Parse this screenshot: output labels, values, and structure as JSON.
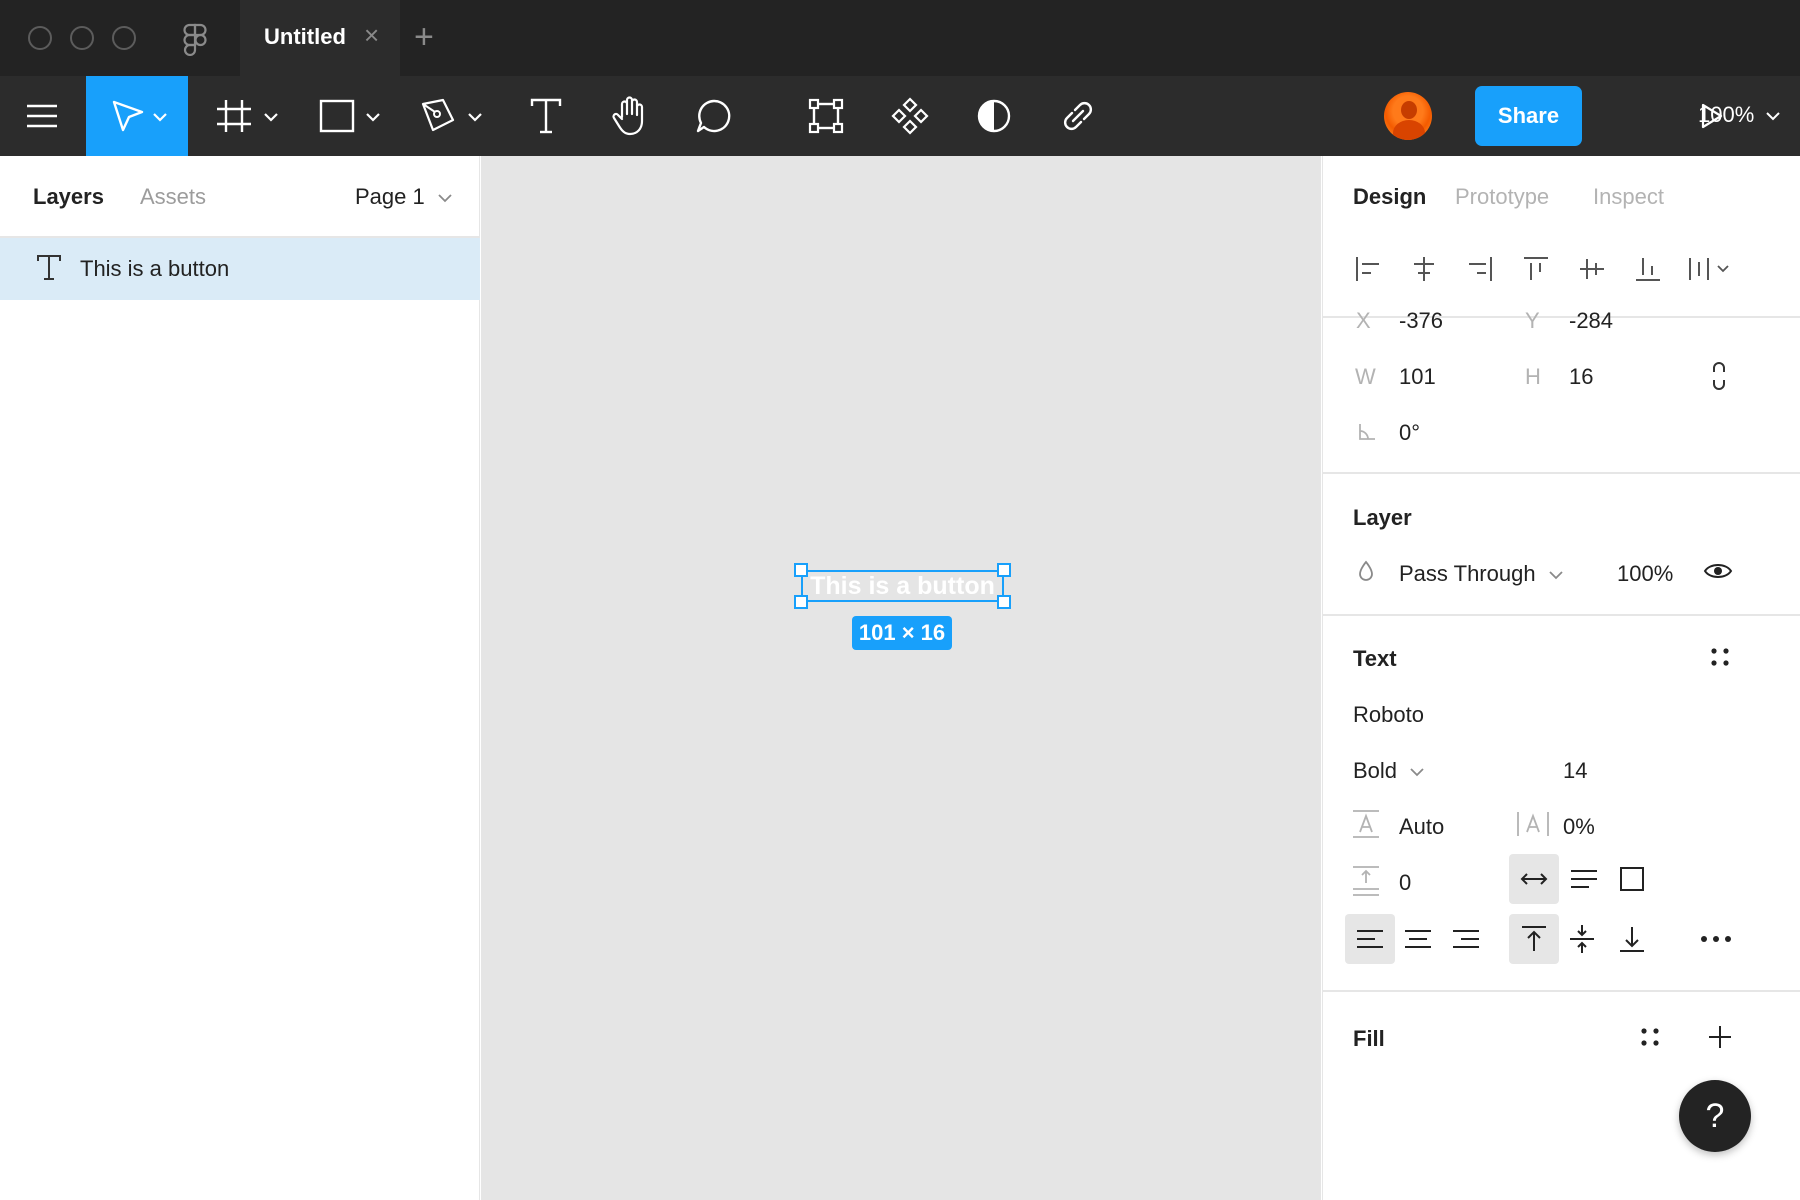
{
  "window": {
    "tab_title": "Untitled",
    "tab_close": "×",
    "new_tab": "+"
  },
  "toolbar": {
    "tools": [
      "menu-icon",
      "move-icon",
      "frame-icon",
      "rectangle-icon",
      "pen-icon",
      "text-icon",
      "hand-icon",
      "comment-icon",
      "boolean-icon",
      "component-icon",
      "mask-icon",
      "link-icon"
    ],
    "share_label": "Share",
    "zoom_label": "100%",
    "accent": "#18a0fb"
  },
  "left_panel": {
    "tab_layers": "Layers",
    "tab_assets": "Assets",
    "page_label": "Page 1",
    "layers": [
      {
        "icon": "text-layer-icon",
        "name": "This is a button",
        "selected": true
      }
    ]
  },
  "canvas": {
    "selected_text": "This is  a button",
    "dimension_badge": "101 × 16",
    "background": "#e5e5e5"
  },
  "right_panel": {
    "tab_design": "Design",
    "tab_prototype": "Prototype",
    "tab_inspect": "Inspect",
    "x_label": "X",
    "x_value": "-376",
    "y_label": "Y",
    "y_value": "-284",
    "w_label": "W",
    "w_value": "101",
    "h_label": "H",
    "h_value": "16",
    "rotation_value": "0°",
    "layer": {
      "title": "Layer",
      "blend_mode": "Pass Through",
      "opacity": "100%"
    },
    "text": {
      "title": "Text",
      "font_family": "Roboto",
      "font_weight": "Bold",
      "font_size": "14",
      "line_height": "Auto",
      "letter_spacing": "0%",
      "paragraph_spacing": "0"
    },
    "fill": {
      "title": "Fill"
    }
  },
  "help": {
    "label": "?"
  }
}
